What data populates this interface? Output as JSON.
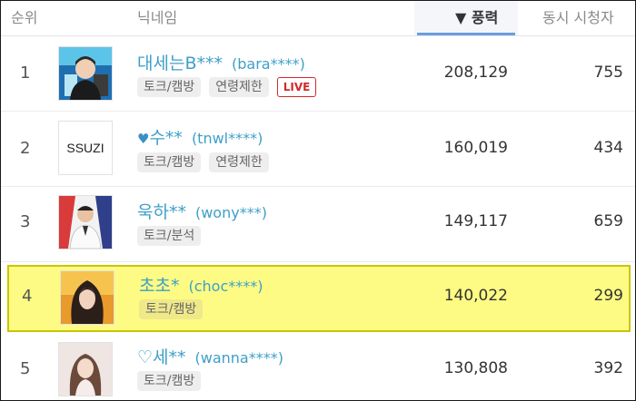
{
  "header": {
    "rank": "순위",
    "nickname": "닉네임",
    "score": "▼ 풍력",
    "viewers": "동시 시청자"
  },
  "colors": {
    "nick_blue": "#3f9fc7",
    "highlight_yellow": "#fdfb83",
    "live_red": "#d12a2a"
  },
  "rows": [
    {
      "rank": "1",
      "thumb": "profile-photo",
      "nick": "대세는B***",
      "id": "(bara****)",
      "tags": [
        "토크/캠방",
        "연령제한"
      ],
      "live": "LIVE",
      "score": "208,129",
      "viewers": "755"
    },
    {
      "rank": "2",
      "thumb_text": "SSUZI",
      "nick_prefix_icon": "heart-icon",
      "nick": "수**",
      "id": "(tnwl****)",
      "tags": [
        "토크/캠방",
        "연령제한"
      ],
      "score": "160,019",
      "viewers": "434"
    },
    {
      "rank": "3",
      "thumb": "profile-photo",
      "nick": "욱하**",
      "id": "(wony***)",
      "tags": [
        "토크/분석"
      ],
      "score": "149,117",
      "viewers": "659"
    },
    {
      "rank": "4",
      "thumb": "profile-photo",
      "nick": "초초*",
      "id": "(choc****)",
      "tags": [
        "토크/캠방"
      ],
      "score": "140,022",
      "viewers": "299",
      "highlighted": true
    },
    {
      "rank": "5",
      "thumb": "profile-photo",
      "nick": "♡세**",
      "id": "(wanna****)",
      "tags": [
        "토크/캠방"
      ],
      "score": "130,808",
      "viewers": "392"
    }
  ]
}
